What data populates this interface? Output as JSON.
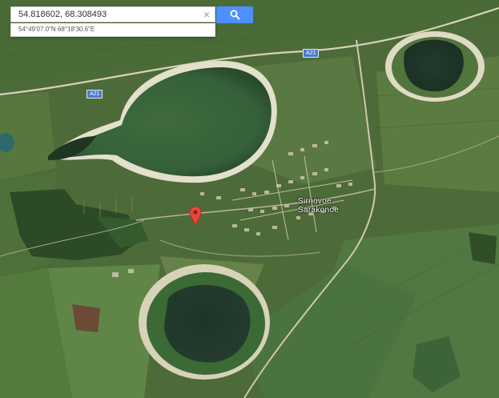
{
  "search": {
    "query": "54.818602, 68.308493",
    "clear_glyph": "×",
    "button_icon": "search-icon"
  },
  "suggestion": {
    "coordinates_dms": "54°49'07.0\"N 68°18'30.6\"E"
  },
  "map": {
    "type": "satellite",
    "road_labels": [
      "A21",
      "A21"
    ],
    "place_labels": [
      "Sirnovoe",
      "Sarakonoe"
    ],
    "marker_icon": "map-pin-icon",
    "colors": {
      "marker": "#e8463d",
      "search_button": "#4d90fe",
      "road_shield": "#4a7bd0"
    }
  }
}
